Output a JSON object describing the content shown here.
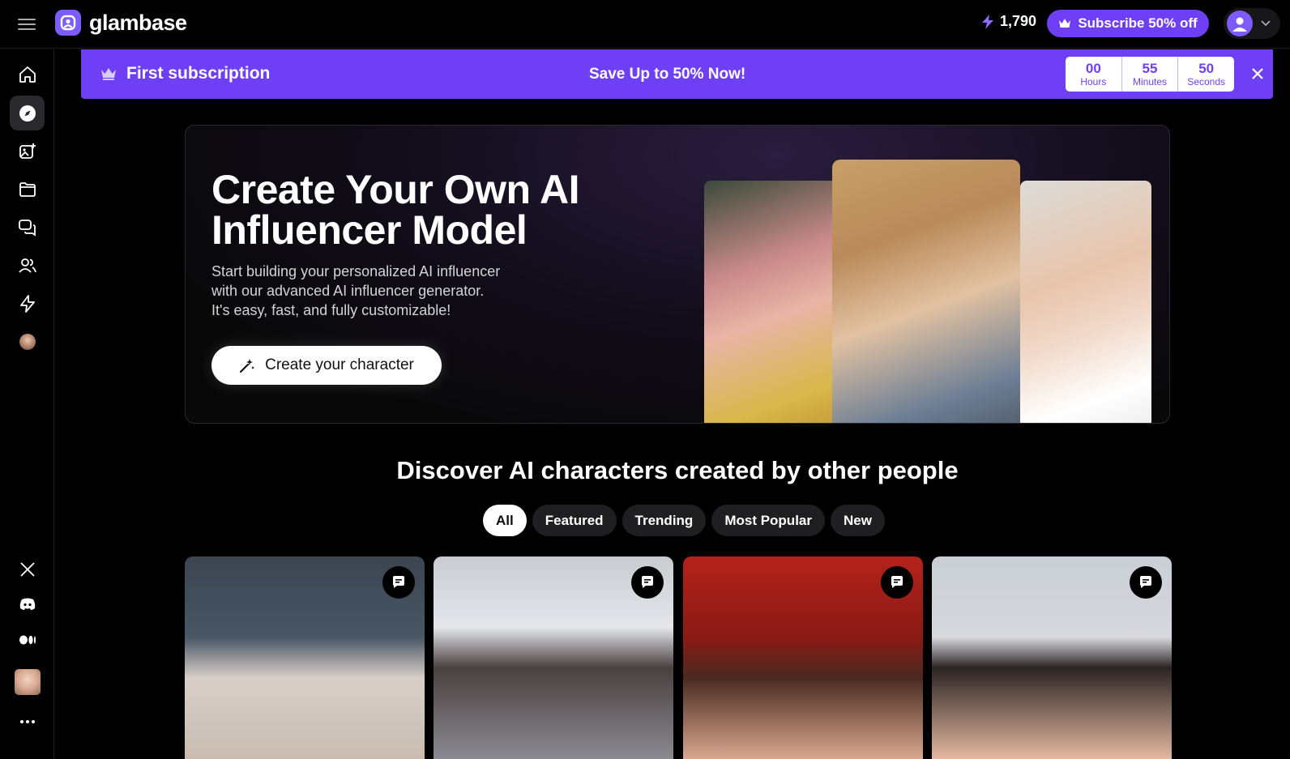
{
  "brand": {
    "name": "glambase"
  },
  "header": {
    "credits": "1,790",
    "subscribe_label": "Subscribe 50% off"
  },
  "sidebar": {
    "items": [
      {
        "name": "home",
        "icon": "home-icon"
      },
      {
        "name": "explore",
        "icon": "compass-icon",
        "active": true
      },
      {
        "name": "create-image",
        "icon": "image-add-icon"
      },
      {
        "name": "collection",
        "icon": "folder-icon"
      },
      {
        "name": "chats",
        "icon": "chat-bubbles-icon"
      },
      {
        "name": "characters",
        "icon": "users-icon"
      },
      {
        "name": "credits",
        "icon": "bolt-icon"
      },
      {
        "name": "my-character",
        "icon": "character-avatar"
      }
    ],
    "bottom": [
      {
        "name": "x",
        "icon": "x-icon"
      },
      {
        "name": "discord",
        "icon": "discord-icon"
      },
      {
        "name": "medium",
        "icon": "medium-icon"
      },
      {
        "name": "profile",
        "icon": "profile-avatar"
      },
      {
        "name": "more",
        "icon": "more-dots-icon"
      }
    ]
  },
  "promo": {
    "title": "First subscription",
    "headline": "Save Up to 50% Now!",
    "timer": {
      "hours": "00",
      "hours_label": "Hours",
      "minutes": "55",
      "minutes_label": "Minutes",
      "seconds": "50",
      "seconds_label": "Seconds"
    }
  },
  "hero": {
    "title_line1": "Create Your Own AI",
    "title_line2": "Influencer Model",
    "sub_line1": "Start building your personalized AI influencer",
    "sub_line2": "with our advanced AI influencer generator.",
    "sub_line3": "It's easy, fast, and fully customizable!",
    "cta": "Create your character"
  },
  "discover": {
    "title": "Discover AI characters created by other people",
    "tabs": [
      {
        "label": "All",
        "active": true
      },
      {
        "label": "Featured"
      },
      {
        "label": "Trending"
      },
      {
        "label": "Most Popular"
      },
      {
        "label": "New"
      }
    ]
  },
  "colors": {
    "accent": "#6f3ff5",
    "logo": "#7c5cff",
    "background": "#000000"
  }
}
